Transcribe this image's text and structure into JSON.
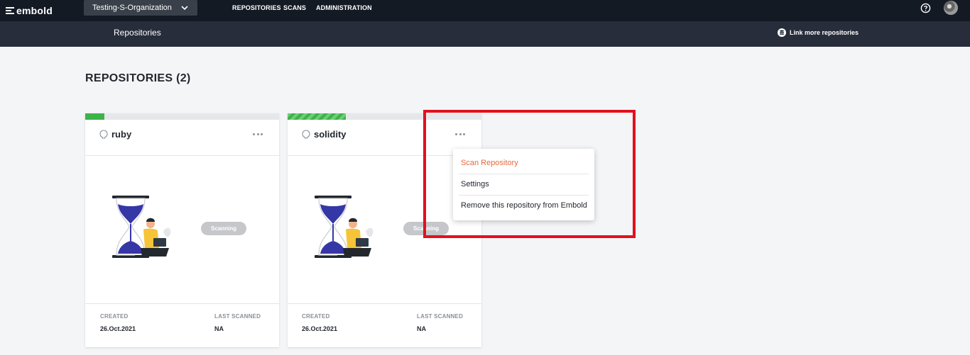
{
  "topbar": {
    "logo_text": "embold",
    "org_selected": "Testing-S-Organization",
    "nav": [
      {
        "label": "REPOSITORIES"
      },
      {
        "label": "SCANS"
      },
      {
        "label": "ADMINISTRATION"
      }
    ],
    "icons": {
      "help": "help-circle-icon",
      "avatar": "user-avatar"
    }
  },
  "subbar": {
    "title": "Repositories",
    "link_more": "Link more repositories",
    "link_icon": "database-icon"
  },
  "main": {
    "heading": "REPOSITORIES (2)"
  },
  "cards": [
    {
      "name": "ruby",
      "repo_icon": "github-icon",
      "status": "Scanning",
      "progress_fraction": 0.1,
      "progress_style": "solid",
      "created_label": "CREATED",
      "created_value": "26.Oct.2021",
      "scanned_label": "LAST SCANNED",
      "scanned_value": "NA"
    },
    {
      "name": "solidity",
      "repo_icon": "github-icon",
      "status": "Scanning",
      "progress_fraction": 0.3,
      "progress_style": "striped",
      "created_label": "CREATED",
      "created_value": "26.Oct.2021",
      "scanned_label": "LAST SCANNED",
      "scanned_value": "NA"
    }
  ],
  "context_menu": {
    "items": [
      {
        "label": "Scan Repository"
      },
      {
        "label": "Settings"
      },
      {
        "label": "Remove this repository from Embold"
      }
    ]
  },
  "colors": {
    "topbar": "#141a24",
    "subbar": "#272d3b",
    "progress": "#3db34a",
    "accent": "#e8683f",
    "highlight": "#e3101d"
  }
}
